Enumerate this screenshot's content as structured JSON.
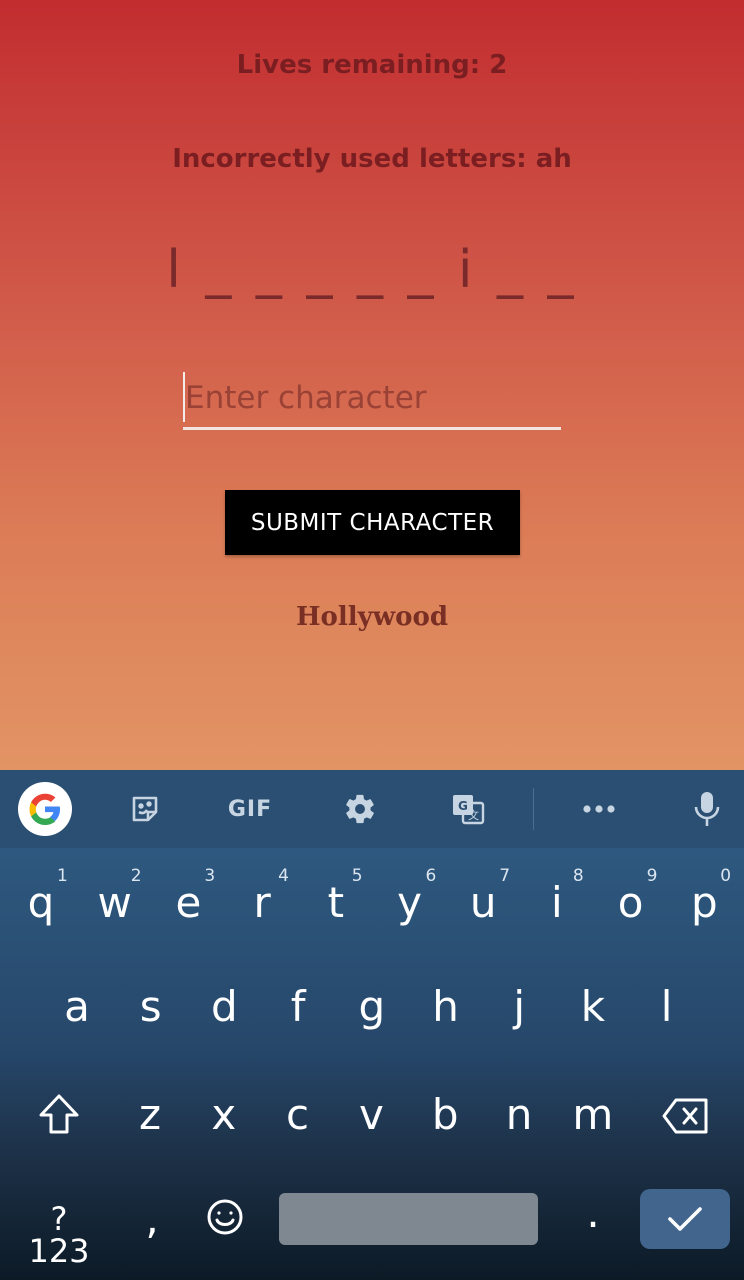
{
  "game": {
    "lives_text": "Lives remaining: 2",
    "incorrect_text": "Incorrectly used letters: ah",
    "word_display": "l _ _ _ _ _ i _ _",
    "input_placeholder": "Enter character",
    "input_value": "",
    "submit_label": "SUBMIT CHARACTER",
    "category": "Hollywood"
  },
  "keyboard": {
    "toolbar": {
      "gif_label": "GIF",
      "icons": [
        "google-icon",
        "sticker-icon",
        "gif-icon",
        "gear-icon",
        "translate-icon",
        "more-icon",
        "microphone-icon"
      ]
    },
    "row1": [
      {
        "k": "q",
        "n": "1"
      },
      {
        "k": "w",
        "n": "2"
      },
      {
        "k": "e",
        "n": "3"
      },
      {
        "k": "r",
        "n": "4"
      },
      {
        "k": "t",
        "n": "5"
      },
      {
        "k": "y",
        "n": "6"
      },
      {
        "k": "u",
        "n": "7"
      },
      {
        "k": "i",
        "n": "8"
      },
      {
        "k": "o",
        "n": "9"
      },
      {
        "k": "p",
        "n": "0"
      }
    ],
    "row2": [
      "a",
      "s",
      "d",
      "f",
      "g",
      "h",
      "j",
      "k",
      "l"
    ],
    "row3": [
      "z",
      "x",
      "c",
      "v",
      "b",
      "n",
      "m"
    ],
    "symbols_label": "?123",
    "comma": ",",
    "period": "."
  }
}
